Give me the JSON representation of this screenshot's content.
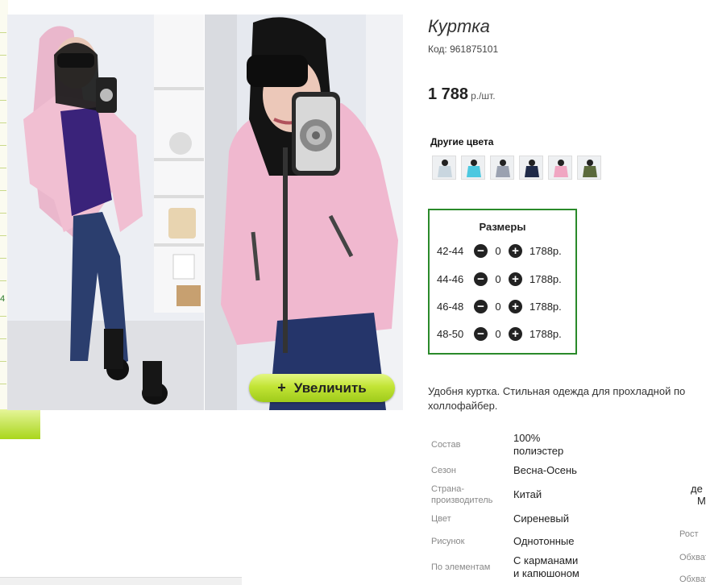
{
  "left_column": {
    "partial_number": "4"
  },
  "product": {
    "title": "Куртка",
    "code": "Код: 961875101",
    "price": "1 788",
    "price_unit": "р./шт.",
    "zoom_label": "Увеличить",
    "other_colors_label": "Другие цвета",
    "swatches": [
      "swatch-1",
      "swatch-2",
      "swatch-3",
      "swatch-4",
      "swatch-5",
      "swatch-6"
    ]
  },
  "sizes": {
    "title": "Размеры",
    "rows": [
      {
        "size": "42-44",
        "qty": "0",
        "price": "1788р."
      },
      {
        "size": "44-46",
        "qty": "0",
        "price": "1788р."
      },
      {
        "size": "46-48",
        "qty": "0",
        "price": "1788р."
      },
      {
        "size": "48-50",
        "qty": "0",
        "price": "1788р."
      }
    ]
  },
  "description": {
    "line1": "Удобня куртка. Стильная одежда для прохладной по",
    "line2": "холлофайбер."
  },
  "properties": [
    {
      "key": "Состав",
      "value1": "100%",
      "value2": "полиэстер"
    },
    {
      "key": "Сезон",
      "value1": "Весна-Осень"
    },
    {
      "key1": "Страна-",
      "key2": "производитель",
      "value1": "Китай"
    },
    {
      "key": "Цвет",
      "value1": "Сиреневый"
    },
    {
      "key": "Рисунок",
      "value1": "Однотонные"
    },
    {
      "key": "По элементам",
      "value1": "С карманами",
      "value2": "и капюшоном"
    }
  ],
  "right_cut": {
    "val1": "де",
    "val2": "М",
    "label_rost": "Рост",
    "label_obhv1": "Обхват",
    "label_obhv2": "Обхват"
  }
}
